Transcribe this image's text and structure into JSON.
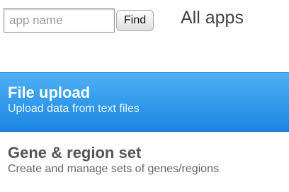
{
  "search": {
    "placeholder": "app name",
    "value": "",
    "button_label": "Find"
  },
  "header": {
    "label": "All apps"
  },
  "apps": [
    {
      "title": "File upload",
      "description": "Upload data from text files",
      "selected": true
    },
    {
      "title": "Gene & region set",
      "description": "Create and manage sets of genes/regions",
      "selected": false
    }
  ],
  "colors": {
    "selected_background": "#2c98ec",
    "selected_text": "#ffffff",
    "normal_title": "#555555",
    "normal_description": "#666666"
  }
}
